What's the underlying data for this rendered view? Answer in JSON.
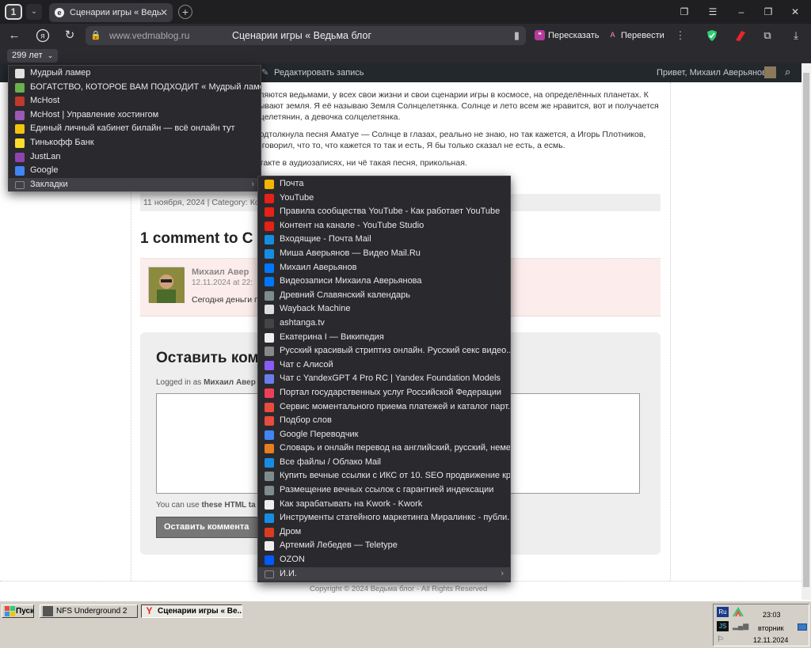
{
  "tabstrip": {
    "tab_count": "1",
    "active_tab_title": "Сценарии игры « Ведь",
    "new_tab_icon": "plus-icon"
  },
  "toolbar": {
    "domain": "www.vedmablog.ru",
    "page_title": "Сценарии игры « Ведьма блог",
    "retell_label": "Пересказать",
    "translate_label": "Перевести"
  },
  "bookmarks_bar": {
    "folder_label": "299 лет"
  },
  "page": {
    "admin_bar": {
      "edit_label": "Редактировать запись",
      "greeting": "Привет, Михаил Аверьянов"
    },
    "article_lines": [
      "вляются ведьмами, у всех свои жизни и свои сценарии игры в космосе, на определённых планетах. К",
      "зывают земля. Я её называю Земля Солнцелетянка. Солнце и лето всем же нравится, вот и получается",
      "нцелетянин, а девочка солцелетянка.",
      "подтолкнула песня Аматуе — Солнце в глазах, реально не знаю, но так кажется, а Игорь Плотников,",
      "е говорил, что то, что кажется то так и есть, Я бы только сказал не есть, а есмь.",
      "нтакте в аудиозаписях, ни чё такая песня, прикольная."
    ],
    "post_meta": "11 ноября, 2024 | Category: Ко",
    "comments_heading": "1 comment to С",
    "comment": {
      "author": "Михаил Авер",
      "date": "12.11.2024 at 22:",
      "text": "Сегодня деньги п"
    },
    "reply": {
      "heading": "Оставить ком",
      "logged_in_prefix": "Logged in as ",
      "logged_in_user": "Михаил Авер",
      "html_hint_prefix": "You can use ",
      "html_hint_link": "these HTML ta",
      "submit_label": "Оставить коммента"
    },
    "footer": "Copyright © 2024 Ведьма блог - All Rights Reserved"
  },
  "bookmarks_menu": {
    "items": [
      {
        "label": "Мудрый ламер",
        "icon": "ghost-icon",
        "color": "#e0e0e0"
      },
      {
        "label": "БОГАТСТВО, КОТОРОЕ ВАМ ПОДХОДИТ « Мудрый ламер",
        "icon": "gear-icon",
        "color": "#6ab04c"
      },
      {
        "label": "McHost",
        "icon": "mchost-icon",
        "color": "#c0392b"
      },
      {
        "label": "McHost | Управление хостингом",
        "icon": "heart-icon",
        "color": "#9b59b6"
      },
      {
        "label": "Единый личный кабинет билайн — всё онлайн тут",
        "icon": "beeline-icon",
        "color": "#f1c40f"
      },
      {
        "label": "Тинькофф Банк",
        "icon": "tinkoff-icon",
        "color": "#ffdd2d"
      },
      {
        "label": "JustLan",
        "icon": "justlan-icon",
        "color": "#8e44ad"
      },
      {
        "label": "Google",
        "icon": "google-icon",
        "color": "#4285f4"
      },
      {
        "label": "Закладки",
        "icon": "folder-icon",
        "color": "#888888",
        "submenu": true
      }
    ]
  },
  "submenu": {
    "items": [
      {
        "label": "Почта",
        "icon": "mail-icon",
        "color": "#f5b400"
      },
      {
        "label": "YouTube",
        "icon": "youtube-icon",
        "color": "#e62117"
      },
      {
        "label": "Правила сообщества YouTube - Как работает YouTube",
        "icon": "youtube-icon",
        "color": "#e62117"
      },
      {
        "label": "Контент на канале - YouTube Studio",
        "icon": "youtube-icon",
        "color": "#e62117"
      },
      {
        "label": "Входящие - Почта Mail",
        "icon": "mailru-icon",
        "color": "#168de2"
      },
      {
        "label": "Миша Аверьянов — Видео Mail.Ru",
        "icon": "mailru-video-icon",
        "color": "#168de2"
      },
      {
        "label": "Михаил Аверьянов",
        "icon": "vk-icon",
        "color": "#0077ff"
      },
      {
        "label": "Видеозаписи Михаила Аверьянова",
        "icon": "vk-icon",
        "color": "#0077ff"
      },
      {
        "label": "Древний Славянский календарь",
        "icon": "calendar-icon",
        "color": "#7f8c8d"
      },
      {
        "label": "Wayback Machine",
        "icon": "archive-icon",
        "color": "#dddddd"
      },
      {
        "label": "ashtanga.tv",
        "icon": "page-icon",
        "color": "#555555"
      },
      {
        "label": "Екатерина I — Википедия",
        "icon": "wikipedia-icon",
        "color": "#eeeeee"
      },
      {
        "label": "Русский красивый стриптиз онлайн. Русский секс видео...",
        "icon": "wifi-icon",
        "color": "#888888"
      },
      {
        "label": "Чат с Алисой",
        "icon": "alice-icon",
        "color": "#8a5cf6"
      },
      {
        "label": "Чат с YandexGPT 4 Pro RC | Yandex Foundation Models",
        "icon": "yandexgpt-icon",
        "color": "#6c7cf0"
      },
      {
        "label": "Портал государственных услуг Российской Федерации",
        "icon": "gosuslugi-icon",
        "color": "#ee3f58"
      },
      {
        "label": "Сервис моментального приема платежей и каталог парт...",
        "icon": "g-icon",
        "color": "#e74c3c"
      },
      {
        "label": "Подбор слов",
        "icon": "chart-icon",
        "color": "#e74c3c"
      },
      {
        "label": "Google Переводчик",
        "icon": "translate-icon",
        "color": "#4285f4"
      },
      {
        "label": "Словарь и онлайн перевод на английский, русский, неме...",
        "icon": "dictionary-icon",
        "color": "#e67e22"
      },
      {
        "label": "Все файлы / Облако Mail",
        "icon": "cloud-icon",
        "color": "#168de2"
      },
      {
        "label": "Купить вечные ссылки с ИКС от 10. SEO продвижение кр...",
        "icon": "link-icon",
        "color": "#7f8c8d"
      },
      {
        "label": "Размещение вечных ссылок с гарантией индексации",
        "icon": "link-icon",
        "color": "#7f8c8d"
      },
      {
        "label": "Как зарабатывать на Kwork - Kwork",
        "icon": "kwork-icon",
        "color": "#eeeeee"
      },
      {
        "label": "Инструменты статейного маркетинга Миралинкс - публи...",
        "icon": "miralinks-icon",
        "color": "#168de2"
      },
      {
        "label": "Дром",
        "icon": "drom-icon",
        "color": "#db3b21"
      },
      {
        "label": "Артемий Лебедев — Teletype",
        "icon": "teletype-icon",
        "color": "#eeeeee"
      },
      {
        "label": "OZON",
        "icon": "ozon-icon",
        "color": "#005bff"
      },
      {
        "label": "И.И.",
        "icon": "folder-icon",
        "color": "#888888",
        "submenu": true
      }
    ]
  },
  "taskbar": {
    "start_label": "Пуск",
    "buttons": [
      {
        "label": "NFS Underground 2"
      },
      {
        "label": "Сценарии игры « Ве..."
      }
    ],
    "tray": {
      "lang": "Ru",
      "time": "23:03",
      "weekday": "вторник",
      "date": "12.11.2024"
    }
  }
}
